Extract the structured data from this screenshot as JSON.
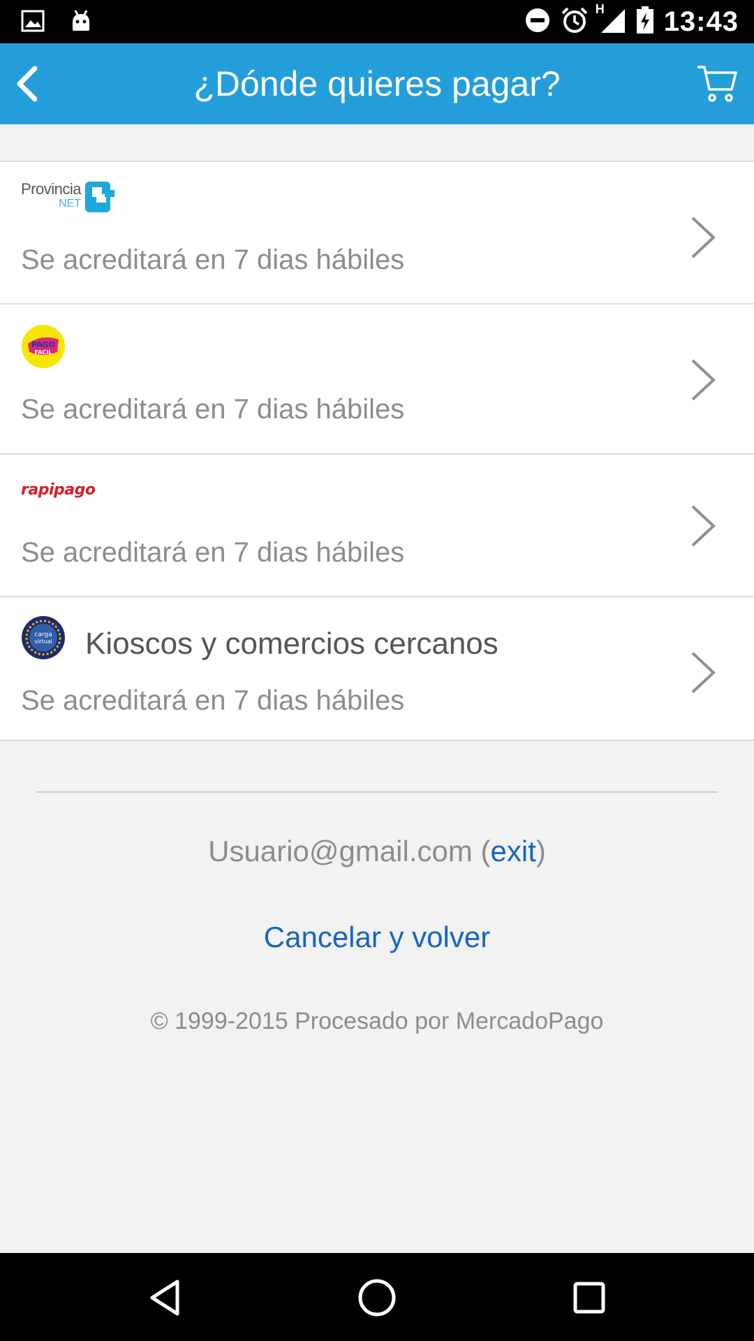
{
  "status_bar": {
    "time": "13:43",
    "network_label": "H",
    "icons": [
      "image-icon",
      "android-icon",
      "do-not-disturb-icon",
      "alarm-icon",
      "signal-icon",
      "battery-charging-icon"
    ]
  },
  "app_bar": {
    "title": "¿Dónde quieres pagar?",
    "back_icon": "chevron-left-icon",
    "cart_icon": "cart-icon",
    "color": "#239edb"
  },
  "payment_options": [
    {
      "logo": "provincia-net-logo",
      "logo_text_1": "Provincia",
      "logo_text_2": "NET",
      "title": "",
      "subtitle": "Se acreditará en 7 dias hábiles"
    },
    {
      "logo": "pago-facil-logo",
      "logo_text_1": "PAGO",
      "logo_text_2": "FACIL",
      "title": "",
      "subtitle": "Se acreditará en 7 dias hábiles"
    },
    {
      "logo": "rapipago-logo",
      "logo_text_1": "rapipago",
      "title": "",
      "subtitle": "Se acreditará en 7 dias hábiles"
    },
    {
      "logo": "carga-virtual-logo",
      "logo_text_1": "carga",
      "logo_text_2": "virtual",
      "title": "Kioscos y comercios cercanos",
      "subtitle": "Se acreditará en 7 dias hábiles"
    }
  ],
  "footer": {
    "user_email": "Usuario@gmail.com",
    "open_paren": " (",
    "exit_label": "exit",
    "close_paren": ")",
    "cancel_label": "Cancelar y volver",
    "copyright": "© 1999-2015 Procesado por MercadoPago",
    "link_color": "#1466c0"
  },
  "nav_bar": {
    "icons": [
      "back-triangle-icon",
      "home-circle-icon",
      "recents-square-icon"
    ]
  }
}
